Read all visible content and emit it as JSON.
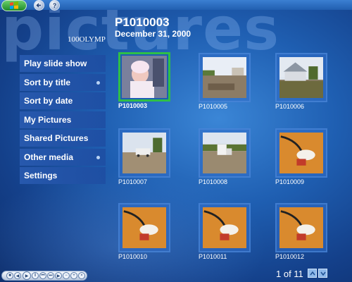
{
  "header": {
    "watermark": "pictures",
    "folder": "100OLYMP",
    "photo_title": "P1010003",
    "photo_date": "December 31, 2000"
  },
  "toolbar": {
    "start_icon": "windows-flag-icon",
    "back_icon": "back-arrow-icon",
    "help_icon": "help-icon",
    "help_label": "?"
  },
  "menu": {
    "items": [
      {
        "label": "Play slide show",
        "has_dot": false
      },
      {
        "label": "Sort by title",
        "has_dot": true
      },
      {
        "label": "Sort by date",
        "has_dot": false
      },
      {
        "label": "My Pictures",
        "has_dot": false
      },
      {
        "label": "Shared Pictures",
        "has_dot": false
      },
      {
        "label": "Other media",
        "has_dot": true
      },
      {
        "label": "Settings",
        "has_dot": false
      }
    ]
  },
  "grid": {
    "tiles": [
      {
        "caption": "P1010003",
        "art": "baby",
        "selected": true
      },
      {
        "caption": "P1010005",
        "art": "site",
        "selected": false
      },
      {
        "caption": "P1010006",
        "art": "house",
        "selected": false
      },
      {
        "caption": "P1010007",
        "art": "truck",
        "selected": false
      },
      {
        "caption": "P1010008",
        "art": "truck",
        "selected": false
      },
      {
        "caption": "P1010009",
        "art": "cable",
        "selected": false
      },
      {
        "caption": "P1010010",
        "art": "cable",
        "selected": false
      },
      {
        "caption": "P1010011",
        "art": "cable",
        "selected": false
      },
      {
        "caption": "P1010012",
        "art": "cable",
        "selected": false
      }
    ]
  },
  "pager": {
    "text": "1 of 11",
    "up_icon": "chevron-up-icon",
    "down_icon": "chevron-down-icon"
  },
  "transport": {
    "icons": [
      "stop-icon",
      "rewind-icon",
      "play-icon",
      "pause-icon",
      "previous-icon",
      "next-icon",
      "fast-forward-icon",
      "volume-down-icon",
      "volume-up-icon",
      "mute-icon"
    ]
  },
  "colors": {
    "accent_selected": "#2fbf47",
    "background": "#1f5fb2"
  }
}
